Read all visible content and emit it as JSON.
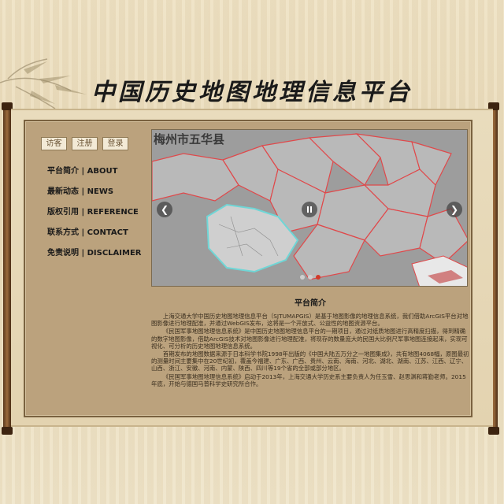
{
  "site": {
    "title": "中国历史地图地理信息平台"
  },
  "top_buttons": [
    {
      "label": "访客"
    },
    {
      "label": "注册"
    },
    {
      "label": "登录"
    }
  ],
  "nav": [
    {
      "label": "平台简介 | ABOUT"
    },
    {
      "label": "最新动态 | NEWS"
    },
    {
      "label": "版权引用 | REFERENCE"
    },
    {
      "label": "联系方式 | CONTACT"
    },
    {
      "label": "免责说明 | DISCLAIMER"
    }
  ],
  "slider": {
    "map_title": "梅州市五华县",
    "prev_icon": "chevron-left-icon",
    "next_icon": "chevron-right-icon",
    "pause_icon": "pause-icon",
    "active_slide": 3,
    "slide_count": 3,
    "colors": {
      "boundary": "#e0484a",
      "highlight": "#6fd6d6",
      "land": "#bcbcbc"
    }
  },
  "intro": {
    "title": "平台简介",
    "paragraphs": [
      "上海交通大学中国历史地图地理信息平台（SJTUMAPGIS）是基于地图影像的地理信息系统，我们借助ArcGIS平台对地图影像进行地理配准，并通过WebGIS发布，这将是一个开放式、公益性的地图资源平台。",
      "《民国军事地图地理信息系统》是中国历史地图地理信息平台的一期项目，通过对纸质地图进行高精度扫描，得到精确的数字地图影像，借助ArcGIS技术对地图影像进行地理配准，将现存的数量庞大的民国大比例尺军事地图连接起来，实现可视化、可分析的历史地图地理信息系统。",
      "首期发布的地图数据来源于日本科学书院1998年出版的《中国大陆五万分之一地图集成》，共有地图4068幅，原图最初的测量时间主要集中在20世纪初，覆盖今福建、广东、广西、贵州、云南、海南、河北、湖北、湖南、江苏、江西、辽宁、山西、浙江、安徽、河南、内蒙、陕西、四川等19个省的全部或部分地区。",
      "《民国军事地图地理信息系统》启动于2013年，上海交通大学历史系主要负责人为任玉雪、赵思渊和蒋勤老师。2015年底，开始与德国马普科学史研究所合作。"
    ]
  }
}
